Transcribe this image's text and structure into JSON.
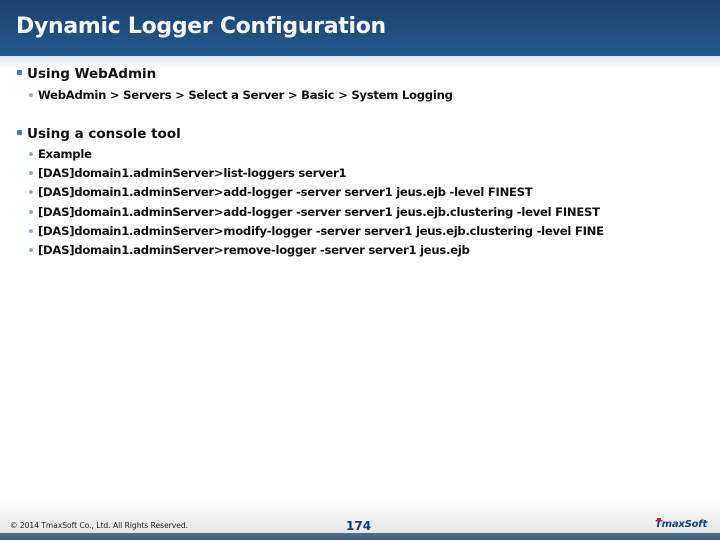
{
  "header": {
    "title": "Dynamic Logger Configuration"
  },
  "sections": [
    {
      "heading": "Using WebAdmin",
      "items": [
        "WebAdmin > Servers > Select a Server > Basic > System Logging"
      ]
    },
    {
      "heading": "Using a console tool",
      "items": [
        "Example",
        "[DAS]domain1.adminServer>list-loggers server1",
        "[DAS]domain1.adminServer>add-logger -server server1 jeus.ejb -level FINEST",
        "[DAS]domain1.adminServer>add-logger -server server1 jeus.ejb.clustering -level FINEST",
        "[DAS]domain1.adminServer>modify-logger -server server1 jeus.ejb.clustering -level FINE",
        "[DAS]domain1.adminServer>remove-logger -server server1 jeus.ejb"
      ]
    }
  ],
  "footer": {
    "copyright": "© 2014 TmaxSoft Co., Ltd. All Rights Reserved.",
    "page_number": "174",
    "logo_text": "TmaxSoft"
  },
  "colors": {
    "header_band": "#1f4c7a",
    "level1_bullet": "#4f7fa6",
    "level2_bullet": "#8ab0c9",
    "logo_accent": "#d11f26",
    "logo_text": "#1b3e6e"
  }
}
